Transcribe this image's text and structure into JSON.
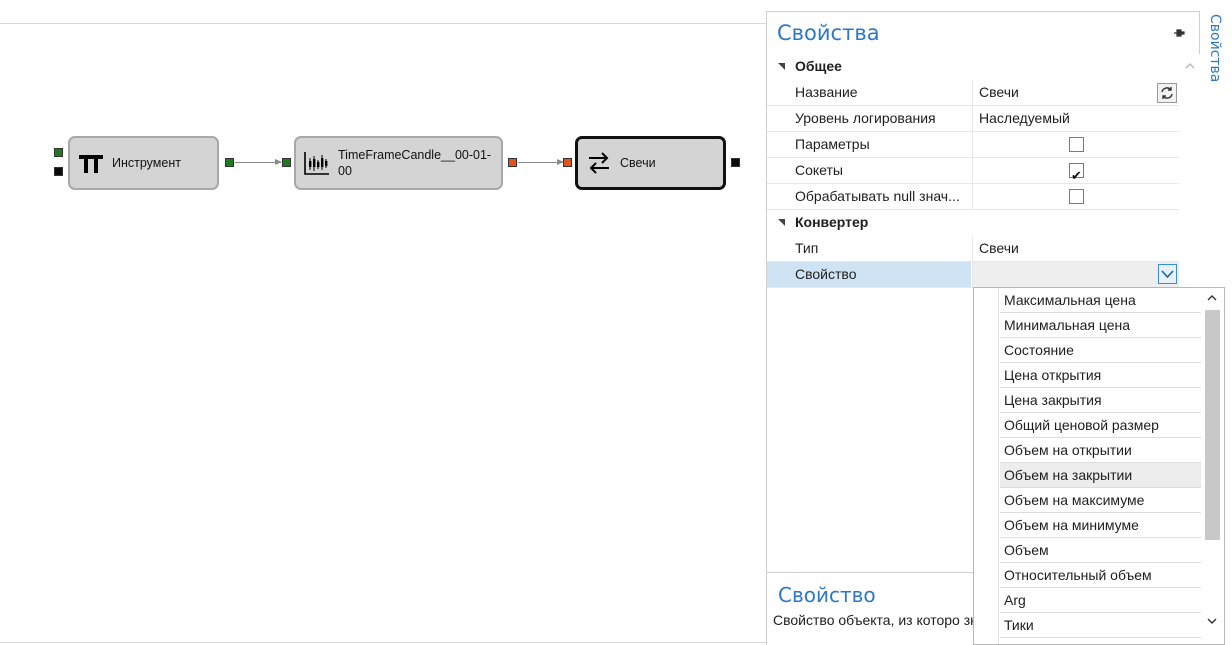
{
  "canvas": {
    "nodes": [
      {
        "label": "Инструмент",
        "icon": "pi-icon"
      },
      {
        "label": "TimeFrameCandle__00-01-00",
        "icon": "candlestick-chart-icon"
      },
      {
        "label": "Свечи",
        "icon": "convert-arrows-icon"
      }
    ],
    "colors": {
      "socket_green": "#1f7a1f",
      "socket_orange": "#e2531d",
      "socket_black": "#0a0a0a",
      "selected_border": "#111111"
    }
  },
  "panel": {
    "title": "Свойства",
    "pin_icon": "pin-icon",
    "categories": [
      {
        "name": "Общее"
      },
      {
        "name": "Конвертер"
      }
    ],
    "rows": {
      "name": {
        "label": "Название",
        "value": "Свечи"
      },
      "log_level": {
        "label": "Уровень логирования",
        "value": "Наследуемый"
      },
      "params": {
        "label": "Параметры",
        "checked": false
      },
      "sockets": {
        "label": "Сокеты",
        "checked": true
      },
      "handle_null": {
        "label": "Обрабатывать null знач...",
        "checked": false
      },
      "type": {
        "label": "Тип",
        "value": "Свечи"
      },
      "property": {
        "label": "Свойство",
        "value": ""
      }
    },
    "description": {
      "title": "Свойство",
      "text": "Свойство объекта, из которо значение."
    }
  },
  "dropdown": {
    "options": [
      "Максимальная цена",
      "Минимальная цена",
      "Состояние",
      "Цена открытия",
      "Цена закрытия",
      "Общий ценовой размер",
      "Объем на открытии",
      "Объем на закрытии",
      "Объем на максимуме",
      "Объем на минимуме",
      "Объем",
      "Относительный объем",
      "Arg",
      "Тики"
    ],
    "highlighted": "Объем на закрытии"
  },
  "side_tab": {
    "label": "Свойства"
  },
  "accent_color": "#2e77c7"
}
